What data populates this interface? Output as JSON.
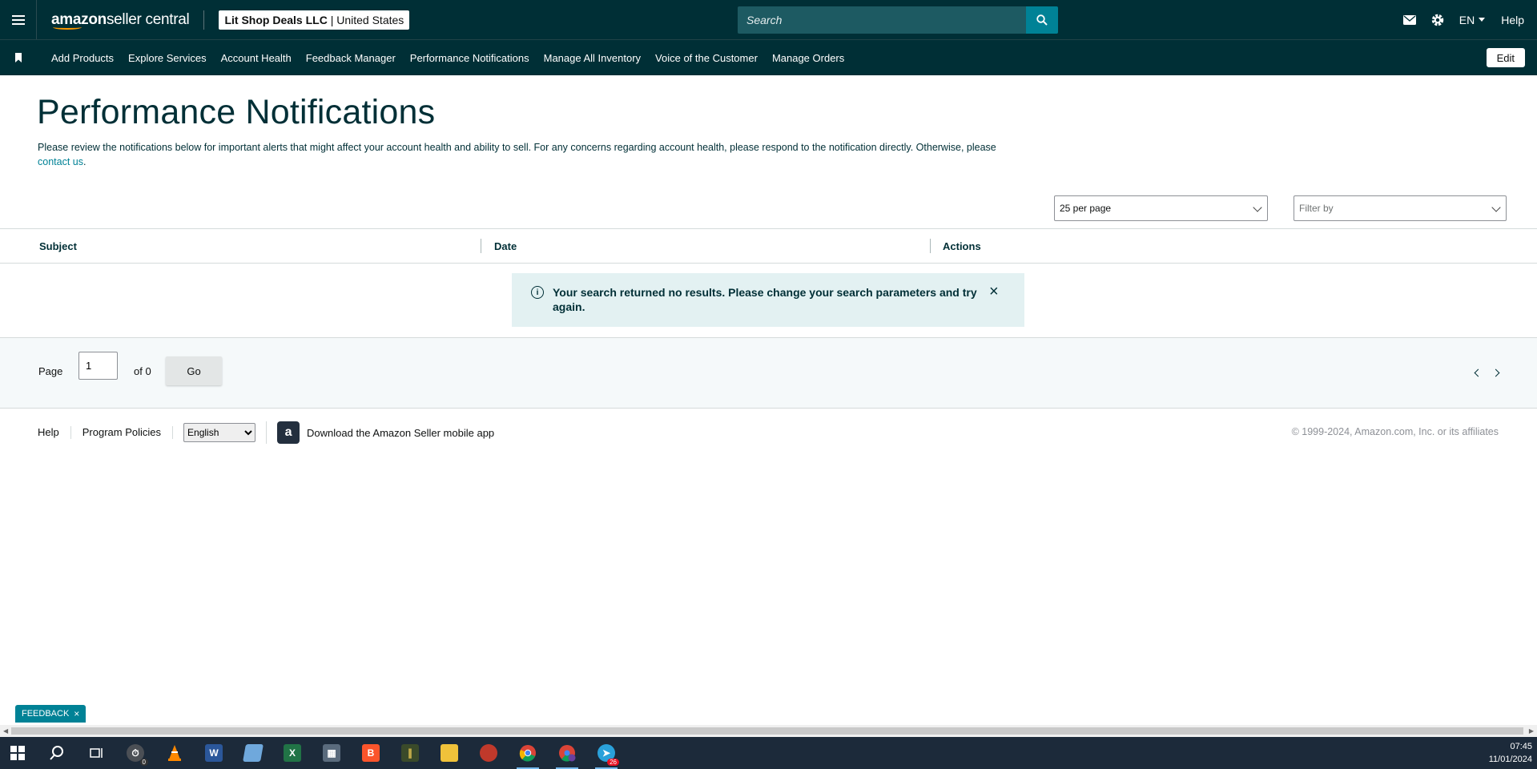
{
  "header": {
    "logo_bold": "amazon",
    "logo_rest": " seller central",
    "store_name": "Lit Shop Deals LLC",
    "store_region": "United States",
    "search_placeholder": "Search",
    "language": "EN",
    "help": "Help"
  },
  "nav": {
    "items": [
      "Add Products",
      "Explore Services",
      "Account Health",
      "Feedback Manager",
      "Performance Notifications",
      "Manage All Inventory",
      "Voice of the Customer",
      "Manage Orders"
    ],
    "edit": "Edit"
  },
  "main": {
    "title": "Performance Notifications",
    "description": "Please review the notifications below for important alerts that might affect your account health and ability to sell. For any concerns regarding account health, please respond to the notification directly. Otherwise, please ",
    "contact_link": "contact us",
    "per_page": "25 per page",
    "filter_placeholder": "Filter by"
  },
  "table": {
    "columns": [
      "Subject",
      "Date",
      "Actions"
    ],
    "no_results": "Your search returned no results. Please change your search parameters and try again."
  },
  "pager": {
    "page_label": "Page",
    "page_value": "1",
    "of_label": "of 0",
    "go": "Go"
  },
  "footer": {
    "help": "Help",
    "program_policies": "Program Policies",
    "language": "English",
    "app_download": "Download the Amazon Seller mobile app",
    "copyright": "© 1999-2024, Amazon.com, Inc. or its affiliates"
  },
  "feedback": "FEEDBACK",
  "taskbar": {
    "time": "07:45",
    "date": "11/01/2024",
    "badges": {
      "clock_app": "0",
      "telegram": "26"
    },
    "icons": [
      "windows-start",
      "search",
      "task-view",
      "alarm-clock",
      "vlc",
      "word",
      "notepad",
      "excel",
      "calculator",
      "brave",
      "library",
      "file-explorer",
      "app-red",
      "chrome",
      "chrome-profile-g",
      "telegram"
    ]
  },
  "colors": {
    "header_bg": "#002f36",
    "accent": "#008296",
    "alert_bg": "#e3f1f2"
  }
}
